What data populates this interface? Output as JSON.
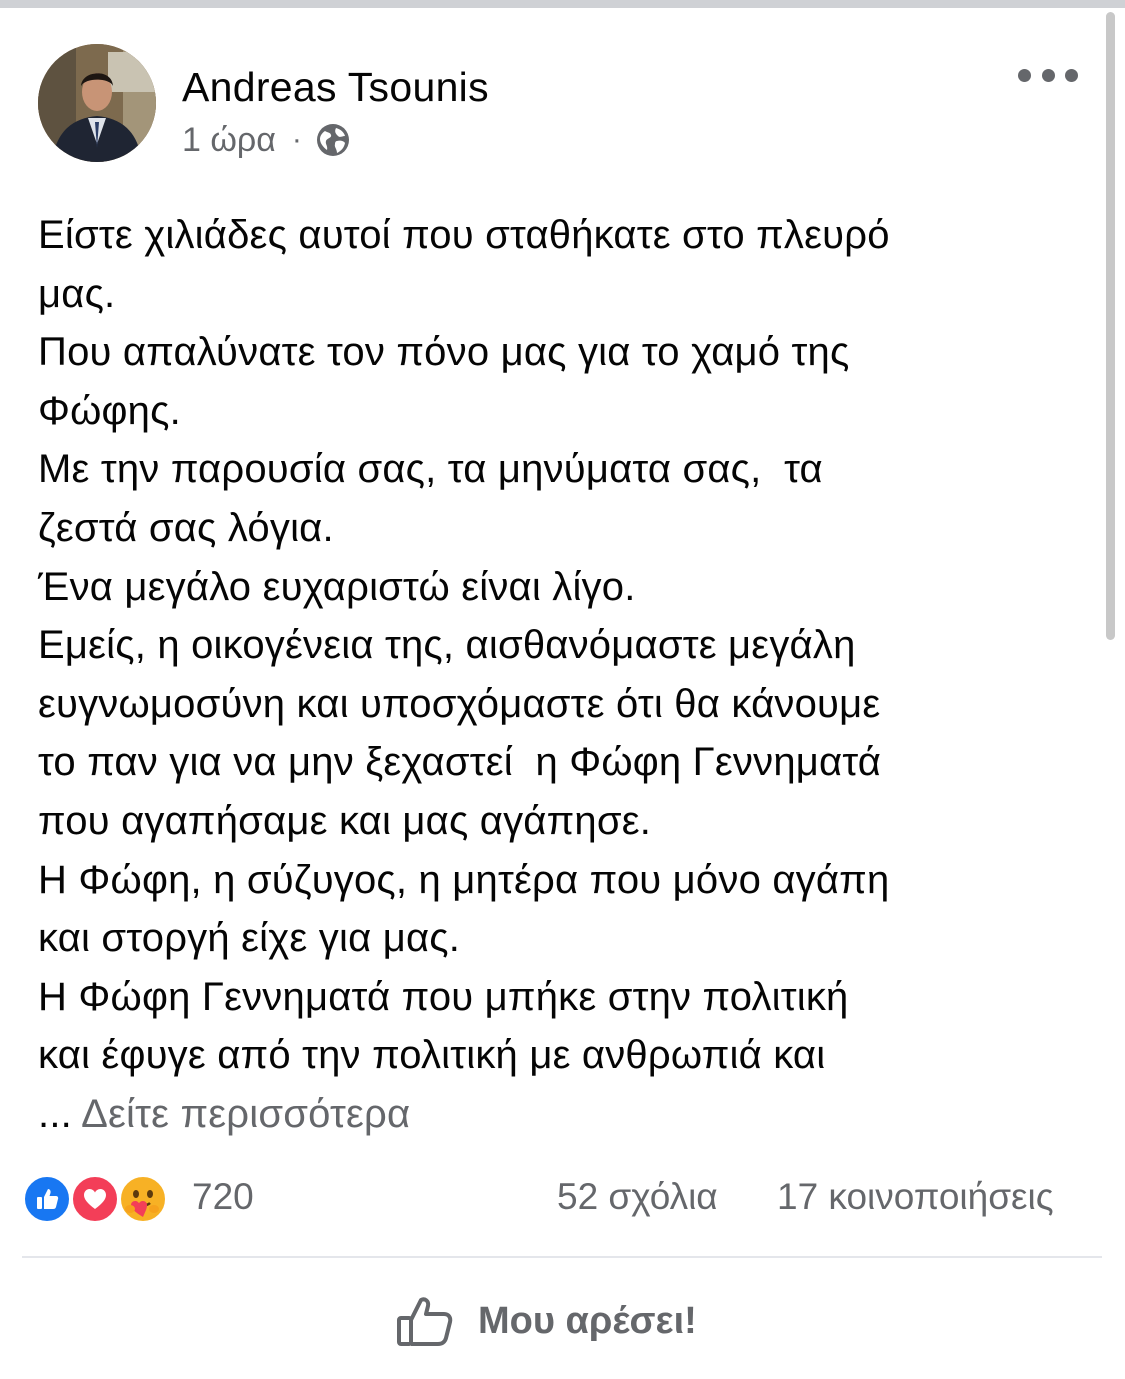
{
  "post": {
    "author": "Andreas Tsounis",
    "time": "1 ώρα",
    "separator": "·",
    "privacy_icon": "globe-icon",
    "more_icon": "more-dots-icon",
    "body_lines": [
      "Είστε χιλιάδες αυτοί που σταθήκατε στο πλευρό",
      "μας.",
      "Που απαλύνατε τον πόνο μας για το χαμό της",
      "Φώφης.",
      "Με την παρουσία σας, τα μηνύματα σας,  τα",
      "ζεστά σας λόγια.",
      "Ένα μεγάλο ευχαριστώ είναι λίγο.",
      "Εμείς, η οικογένεια της, αισθανόμαστε μεγάλη",
      "ευγνωμοσύνη και υποσχόμαστε ότι θα κάνουμε",
      "το παν για να μην ξεχαστεί  η Φώφη Γεννηματά",
      "που αγαπήσαμε και μας αγάπησε.",
      "Η Φώφη, η σύζυγος, η μητέρα που μόνο αγάπη",
      "και στοργή είχε για μας.",
      "Η Φώφη Γεννηματά που μπήκε στην πολιτική",
      "και έφυγε από την πολιτική με ανθρωπιά και"
    ],
    "ellipsis": "...",
    "see_more": "Δείτε περισσότερα"
  },
  "stats": {
    "reaction_icons": [
      "like-reaction-icon",
      "love-reaction-icon",
      "care-reaction-icon"
    ],
    "reaction_count": "720",
    "comments": "52 σχόλια",
    "shares": "17 κοινοποιήσεις"
  },
  "actions": {
    "like_label": "Μου αρέσει!",
    "like_icon": "thumbs-up-icon"
  },
  "colors": {
    "text": "#050505",
    "secondary": "#65676b",
    "like_blue": "#1877f2",
    "love_red": "#f33e58",
    "care_yellow": "#f7b125",
    "divider": "#e4e6eb"
  }
}
